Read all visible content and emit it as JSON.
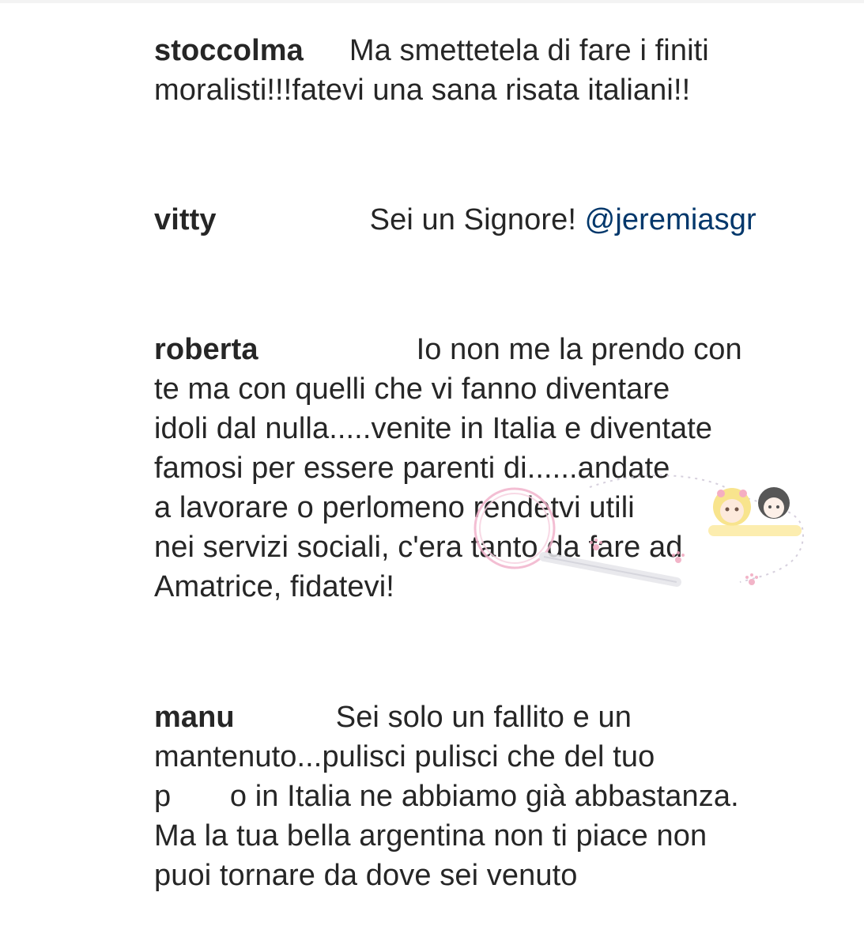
{
  "comments": [
    {
      "username": "stoccolma",
      "lines": [
        "Ma smettetela di fare i finiti",
        "moralisti!!!fatevi una sana risata italiani!!"
      ]
    },
    {
      "username": "vitty",
      "text": "Sei un Signore! ",
      "mention": "@jeremiasgr"
    },
    {
      "username": "roberta",
      "lines": [
        "Io non me la prendo con",
        "te ma con quelli che vi fanno diventare",
        "idoli dal nulla.....venite in Italia e diventate",
        "famosi per essere parenti di......andate",
        "a lavorare o perlomeno rendetvi utili",
        "nei servizi sociali, c'era tanto da fare ad",
        "Amatrice, fidatevi!"
      ]
    },
    {
      "username": "manu",
      "lines": [
        "Sei solo un fallito e un",
        "mantenuto...pulisci pulisci che del tuo",
        "p       o in Italia ne abbiamo già abbastanza.",
        "Ma la tua bella argentina non ti piace non",
        "puoi tornare da dove sei venuto"
      ]
    }
  ]
}
